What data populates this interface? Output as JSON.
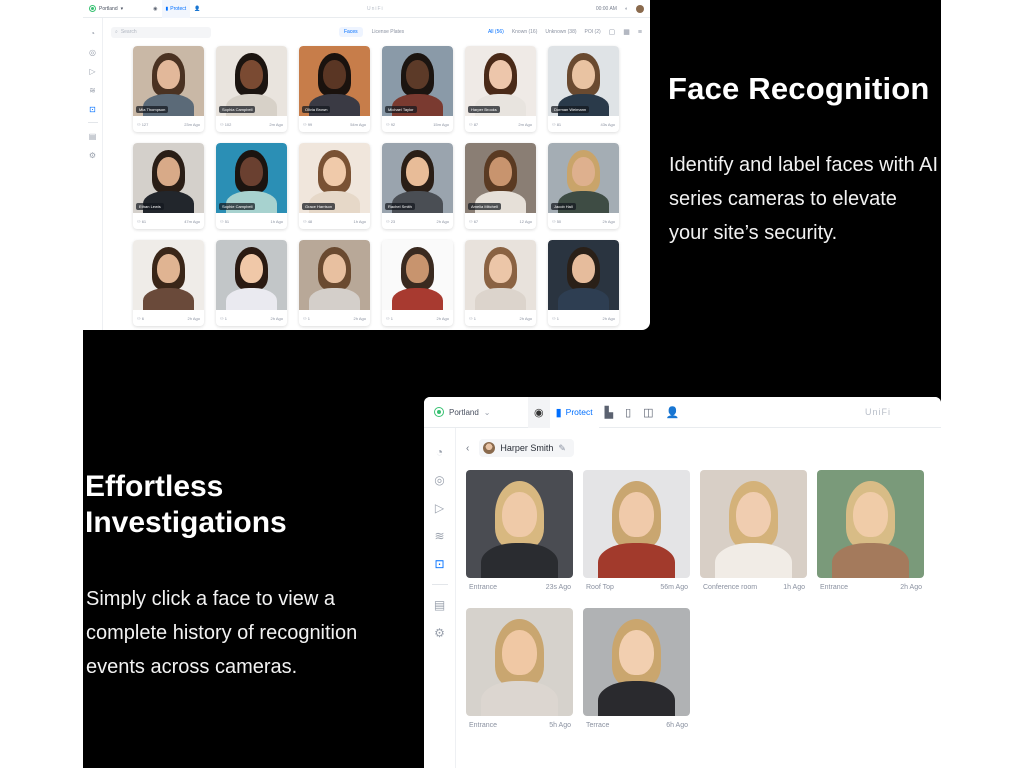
{
  "marketing": {
    "face_title": "Face Recognition",
    "face_desc": "Identify and label faces with AI series cameras to elevate your site’s security.",
    "investigate_title_1": "Effortless",
    "investigate_title_2": "Investigations",
    "investigate_desc": "Simply click a face to view a complete history of recognition events across cameras."
  },
  "faces_window": {
    "site": "Portland",
    "app_tab": "Protect",
    "brand": "UniFi",
    "time": "00:00 AM",
    "search_placeholder": "Search",
    "segments": [
      "Faces",
      "License Plates"
    ],
    "filters": [
      "All (56)",
      "Known (16)",
      "Unknown (38)",
      "POI (2)"
    ],
    "cards": [
      {
        "name": "Mia Thompson",
        "count": "127",
        "ago": "23m Ago",
        "bg": "#c9b8a6",
        "skin": "#e2b89a",
        "hair": "#4a3222",
        "shirt": "#5b6a78"
      },
      {
        "name": "Sophia Campbell",
        "count": "102",
        "ago": "2m Ago",
        "bg": "#e9e4de",
        "skin": "#7a4a32",
        "hair": "#1b1410",
        "shirt": "#d7d1c8"
      },
      {
        "name": "Olivia Brown",
        "count": "99",
        "ago": "54m Ago",
        "bg": "#c77d4a",
        "skin": "#5a3624",
        "hair": "#1a120e",
        "shirt": "#3a3a44"
      },
      {
        "name": "Michael Taylor",
        "count": "92",
        "ago": "15m Ago",
        "bg": "#8a9aa8",
        "skin": "#5c3a28",
        "hair": "#1b1410",
        "shirt": "#7a3a30"
      },
      {
        "name": "Harper Brooks",
        "count": "87",
        "ago": "2m Ago",
        "bg": "#efeae6",
        "skin": "#edc6ab",
        "hair": "#4a2a18",
        "shirt": "#e8e4df"
      },
      {
        "name": "Dorman Weimann",
        "count": "81",
        "ago": "43s Ago",
        "bg": "#dfe3e6",
        "skin": "#e9c3a2",
        "hair": "#6a4a30",
        "shirt": "#2a3a4a"
      },
      {
        "name": "Ethan Lewis",
        "count": "61",
        "ago": "47m Ago",
        "bg": "#d4d0cb",
        "skin": "#d8aa88",
        "hair": "#2a1e16",
        "shirt": "#22262c"
      },
      {
        "name": "Sophie Campbell",
        "count": "51",
        "ago": "1h Ago",
        "bg": "#2b8fb5",
        "skin": "#6a4030",
        "hair": "#1b1410",
        "shirt": "#a7d2cf"
      },
      {
        "name": "Grace Harrison",
        "count": "48",
        "ago": "1h Ago",
        "bg": "#f0e6dc",
        "skin": "#f0caaa",
        "hair": "#7a5234",
        "shirt": "#e6d8c8"
      },
      {
        "name": "Rachel Smith",
        "count": "23",
        "ago": "2h Ago",
        "bg": "#9aa4ae",
        "skin": "#e8bc98",
        "hair": "#2a1e16",
        "shirt": "#4a4e54"
      },
      {
        "name": "Amelia Mitchell",
        "count": "67",
        "ago": "12 Ago",
        "bg": "#8a7e74",
        "skin": "#c8946e",
        "hair": "#5a3a22",
        "shirt": "#e6e0d8"
      },
      {
        "name": "Jacob Hall",
        "count": "50",
        "ago": "2h Ago",
        "bg": "#a4adb4",
        "skin": "#deb08e",
        "hair": "#c9a46a",
        "shirt": "#3e4c44"
      },
      {
        "name": "",
        "count": "6",
        "ago": "2h Ago",
        "bg": "#efece8",
        "skin": "#e0b492",
        "hair": "#3a2618",
        "shirt": "#6a4a3a"
      },
      {
        "name": "",
        "count": "1",
        "ago": "2h Ago",
        "bg": "#c2c6c8",
        "skin": "#f0c8a8",
        "hair": "#2a1a12",
        "shirt": "#eaeaf0"
      },
      {
        "name": "",
        "count": "1",
        "ago": "2h Ago",
        "bg": "#b8a898",
        "skin": "#e8c0a0",
        "hair": "#6a4a30",
        "shirt": "#d4cfca"
      },
      {
        "name": "",
        "count": "1",
        "ago": "2h Ago",
        "bg": "#fafafa",
        "skin": "#c8946e",
        "hair": "#3a2a20",
        "shirt": "#a83a30"
      },
      {
        "name": "",
        "count": "1",
        "ago": "2h Ago",
        "bg": "#e8e2dc",
        "skin": "#ecc6a8",
        "hair": "#8a6242",
        "shirt": "#dcd4cc"
      },
      {
        "name": "",
        "count": "1",
        "ago": "2h Ago",
        "bg": "#2a3440",
        "skin": "#e6bc9c",
        "hair": "#2a2018",
        "shirt": "#2e3e52"
      }
    ]
  },
  "detail_window": {
    "site": "Portland",
    "app_tab": "Protect",
    "brand": "UniFi",
    "person": "Harper Smith",
    "events": [
      {
        "camera": "Entrance",
        "ago": "23s Ago",
        "bg": "#4a4c52",
        "skin": "#efcaa8",
        "hair": "#d8b880",
        "shirt": "#2a2c30"
      },
      {
        "camera": "Roof Top",
        "ago": "56m Ago",
        "bg": "#e4e4e6",
        "skin": "#f0caaa",
        "hair": "#c9a670",
        "shirt": "#a23a2c"
      },
      {
        "camera": "Conference room",
        "ago": "1h Ago",
        "bg": "#d8cfc6",
        "skin": "#f0cdb0",
        "hair": "#d4b27a",
        "shirt": "#f1ece6"
      },
      {
        "camera": "Entrance",
        "ago": "2h Ago",
        "bg": "#7a9a7a",
        "skin": "#f0cca8",
        "hair": "#d8bc86",
        "shirt": "#a47a5c"
      },
      {
        "camera": "Entrance",
        "ago": "5h Ago",
        "bg": "#d6d2cc",
        "skin": "#f0c8a4",
        "hair": "#c9a670",
        "shirt": "#dcd6d0"
      },
      {
        "camera": "Terrace",
        "ago": "6h Ago",
        "bg": "#b0b2b4",
        "skin": "#f2cfb0",
        "hair": "#caa66e",
        "shirt": "#2a2a2e"
      }
    ]
  },
  "icons": {
    "site": "site-status-icon",
    "protect": "protect-app-icon",
    "accent": "#006fff",
    "status": "#38c172"
  }
}
